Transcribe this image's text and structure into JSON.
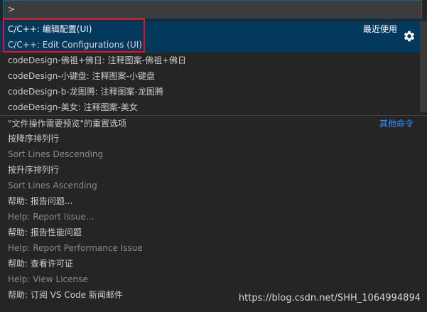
{
  "search": {
    "value": ">"
  },
  "items": [
    {
      "primary": "C/C++: 编辑配置(UI)",
      "secondary": "C/C++: Edit Configurations (UI)",
      "right": "最近使用",
      "selected": true
    },
    {
      "primary": "codeDesign-佛祖+佛日: 注释图案-佛祖+佛日"
    },
    {
      "primary": "codeDesign-小键盘: 注释图案-小键盘"
    },
    {
      "primary": "codeDesign-b-龙图腾: 注释图案-龙图腾"
    },
    {
      "primary": "codeDesign-美女: 注释图案-美女"
    },
    {
      "primary": "\"文件操作需要预览\"的重置选项",
      "right": "其他命令"
    },
    {
      "primary": "按降序排列行",
      "secondary": "Sort Lines Descending"
    },
    {
      "primary": "按升序排列行",
      "secondary": "Sort Lines Ascending"
    },
    {
      "primary": "帮助: 报告问题...",
      "secondary": "Help: Report Issue..."
    },
    {
      "primary": "帮助: 报告性能问题",
      "secondary": "Help: Report Performance Issue"
    },
    {
      "primary": "帮助: 查看许可证",
      "secondary": "Help: View License"
    },
    {
      "primary": "帮助: 订阅 VS Code 新闻邮件"
    }
  ],
  "watermark": "https://blog.csdn.net/SHH_1064994894",
  "colors": {
    "selection": "#04395e",
    "highlight_box": "#e81123",
    "link": "#3794ff"
  },
  "icons": {
    "gear": "gear-icon"
  }
}
